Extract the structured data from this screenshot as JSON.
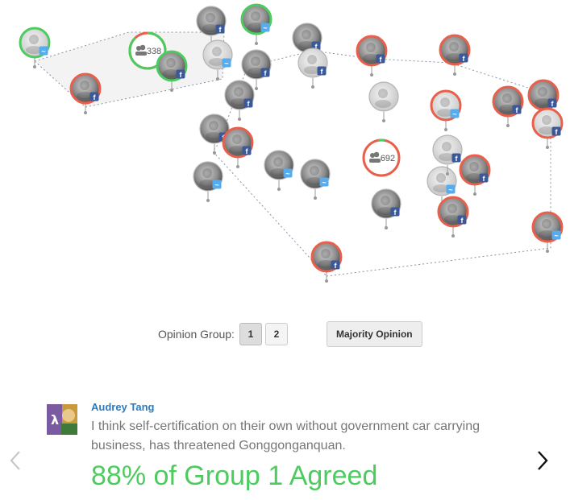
{
  "controls": {
    "opinion_group_label": "Opinion Group:",
    "group_buttons": [
      "1",
      "2"
    ],
    "active_group": "1",
    "majority_label": "Majority Opinion"
  },
  "groups": [
    {
      "count_label": "338",
      "icon": "people-icon"
    },
    {
      "count_label": "692",
      "icon": "people-icon"
    }
  ],
  "comment": {
    "author": "Audrey Tang",
    "text": "I think self-certification on their own without government car carrying business, has threatened Gonggonganquan.",
    "agreement": "88% of Group 1 Agreed"
  },
  "colors": {
    "agree_green": "#4ccb5f",
    "disagree_red": "#e8604c",
    "facebook_blue": "#3b5998",
    "twitter_blue": "#55acee",
    "link_blue": "#2a7bc4"
  },
  "participants": [
    {
      "id": "p1",
      "ring": "green",
      "badge": "twitter"
    },
    {
      "id": "p2",
      "ring": "red",
      "badge": "facebook"
    },
    {
      "id": "p3",
      "ring": "gray",
      "badge": "facebook"
    },
    {
      "id": "p4",
      "ring": "green",
      "badge": "twitter"
    },
    {
      "id": "p5",
      "ring": "green",
      "badge": "facebook"
    },
    {
      "id": "p6",
      "ring": "gray",
      "badge": "twitter"
    },
    {
      "id": "p7",
      "ring": "gray",
      "badge": "facebook"
    },
    {
      "id": "p8",
      "ring": "gray",
      "badge": "facebook"
    },
    {
      "id": "p9",
      "ring": "gray",
      "badge": "facebook"
    },
    {
      "id": "p10",
      "ring": "gray",
      "badge": "facebook"
    },
    {
      "id": "p11",
      "ring": "gray",
      "badge": "none"
    },
    {
      "id": "p12",
      "ring": "red",
      "badge": "facebook"
    },
    {
      "id": "p13",
      "ring": "gray",
      "badge": "facebook"
    },
    {
      "id": "p14",
      "ring": "gray",
      "badge": "twitter"
    },
    {
      "id": "p15",
      "ring": "gray",
      "badge": "twitter"
    },
    {
      "id": "p16",
      "ring": "red",
      "badge": "twitter"
    },
    {
      "id": "p17",
      "ring": "red",
      "badge": "facebook"
    },
    {
      "id": "p18",
      "ring": "gray",
      "badge": "twitter"
    },
    {
      "id": "p19",
      "ring": "gray",
      "badge": "facebook"
    },
    {
      "id": "p20",
      "ring": "red",
      "badge": "facebook"
    },
    {
      "id": "p21",
      "ring": "gray",
      "badge": "twitter"
    },
    {
      "id": "p22",
      "ring": "gray",
      "badge": "facebook"
    },
    {
      "id": "p23",
      "ring": "red",
      "badge": "facebook"
    },
    {
      "id": "p24",
      "ring": "red",
      "badge": "facebook"
    },
    {
      "id": "p25",
      "ring": "red",
      "badge": "facebook"
    },
    {
      "id": "p26",
      "ring": "red",
      "badge": "facebook"
    },
    {
      "id": "p27",
      "ring": "red",
      "badge": "facebook"
    },
    {
      "id": "p28",
      "ring": "red",
      "badge": "facebook"
    },
    {
      "id": "p29",
      "ring": "red",
      "badge": "twitter"
    }
  ]
}
